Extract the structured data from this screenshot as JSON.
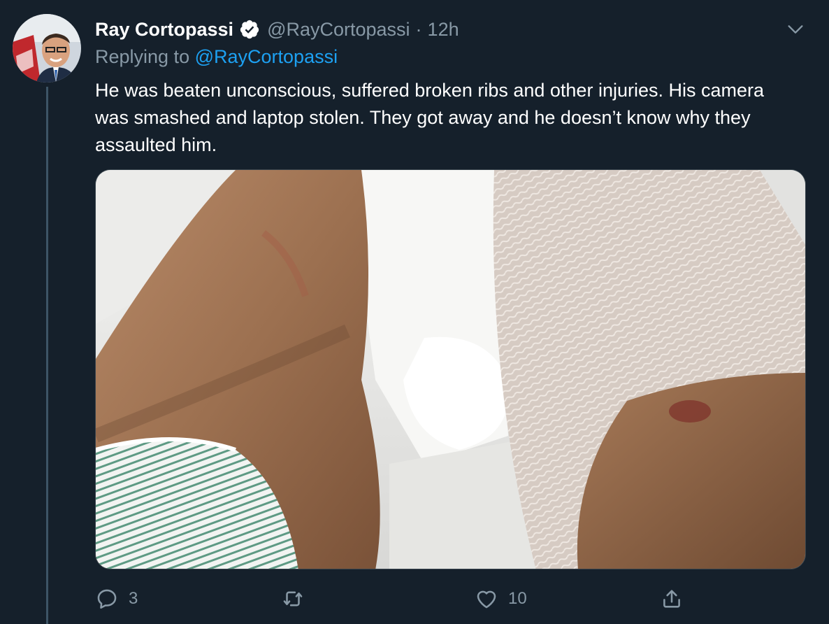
{
  "tweet": {
    "display_name": "Ray Cortopassi",
    "handle": "@RayCortopassi",
    "separator": "·",
    "time": "12h",
    "replying_label": "Replying to",
    "replying_to": "@RayCortopassi",
    "body": "He was beaten unconscious, suffered broken ribs and other injuries. His camera was smashed and laptop stolen. They got away and he doesn’t know why they assaulted him."
  },
  "actions": {
    "reply_count": "3",
    "retweet_count": "",
    "like_count": "10"
  },
  "icons": {
    "verified": "verified-badge-icon",
    "menu": "chevron-down-icon",
    "reply": "reply-icon",
    "retweet": "retweet-icon",
    "like": "heart-icon",
    "share": "share-icon"
  },
  "colors": {
    "background": "#15202b",
    "text": "#ffffff",
    "secondary": "#8899a6",
    "accent": "#1da1f2"
  }
}
